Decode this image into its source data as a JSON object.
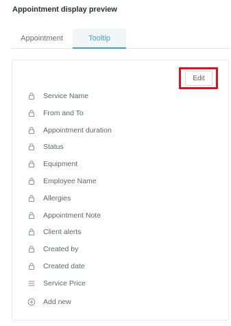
{
  "page": {
    "title": "Appointment display preview"
  },
  "tabs": [
    {
      "label": "Appointment",
      "active": false
    },
    {
      "label": "Tooltip",
      "active": true
    }
  ],
  "panel": {
    "edit_label": "Edit",
    "fields": [
      {
        "label": "Service Name",
        "icon": "lock-icon"
      },
      {
        "label": "From and To",
        "icon": "lock-icon"
      },
      {
        "label": "Appointment duration",
        "icon": "lock-icon"
      },
      {
        "label": "Status",
        "icon": "lock-icon"
      },
      {
        "label": "Equipment",
        "icon": "lock-icon"
      },
      {
        "label": "Employee Name",
        "icon": "lock-icon"
      },
      {
        "label": "Allergies",
        "icon": "lock-icon"
      },
      {
        "label": "Appointment Note",
        "icon": "lock-icon"
      },
      {
        "label": "Client alerts",
        "icon": "lock-icon"
      },
      {
        "label": "Created by",
        "icon": "lock-icon"
      },
      {
        "label": "Created date",
        "icon": "lock-icon"
      },
      {
        "label": "Service Price",
        "icon": "drag-handle-icon"
      }
    ],
    "add_new_label": "Add new",
    "add_new_icon": "plus-circle-icon"
  },
  "colors": {
    "accent": "#3aa3cc",
    "highlight": "#e0101c",
    "border": "#e6e9ec"
  }
}
